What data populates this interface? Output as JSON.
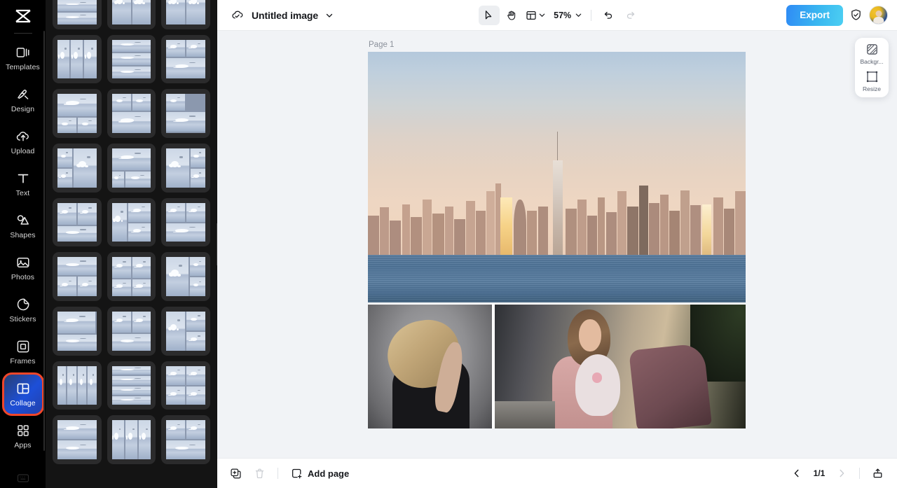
{
  "app": {
    "name": "CapCut",
    "logo_icon": "capcut-logo-icon"
  },
  "sidebar": {
    "items": [
      {
        "label": "Templates",
        "icon": "templates-icon",
        "active": false
      },
      {
        "label": "Design",
        "icon": "design-icon",
        "active": false
      },
      {
        "label": "Upload",
        "icon": "upload-cloud-icon",
        "active": false
      },
      {
        "label": "Text",
        "icon": "text-icon",
        "active": false
      },
      {
        "label": "Shapes",
        "icon": "shapes-icon",
        "active": false
      },
      {
        "label": "Photos",
        "icon": "photos-icon",
        "active": false
      },
      {
        "label": "Stickers",
        "icon": "stickers-icon",
        "active": false
      },
      {
        "label": "Frames",
        "icon": "frames-icon",
        "active": false
      },
      {
        "label": "Collage",
        "icon": "collage-icon",
        "active": true
      },
      {
        "label": "Apps",
        "icon": "apps-grid-icon",
        "active": false
      }
    ],
    "bottom_icon": "keyboard-icon",
    "active_highlight_color": "#f0462a",
    "active_fill_color": "#1d4fd8",
    "background_color": "#000000"
  },
  "template_panel": {
    "background_color": "#141414",
    "collapse_handle_icon": "chevron-left-icon",
    "layouts": [
      {
        "cols": "1fr",
        "rows": "1.1fr 1fr 1fr",
        "cells": [
          [
            1,
            1
          ],
          [
            1,
            1
          ],
          [
            1,
            1
          ]
        ]
      },
      {
        "cols": "1fr 1fr",
        "rows": "1fr",
        "cells": [
          [
            1,
            1
          ],
          [
            1,
            1
          ]
        ]
      },
      {
        "cols": "1fr 1fr",
        "rows": "1fr",
        "cells": [
          [
            1,
            1
          ],
          [
            1,
            1
          ]
        ]
      },
      {
        "cols": "1fr 1fr 1fr",
        "rows": "1fr",
        "cells": [
          [
            1,
            1
          ],
          [
            1,
            1
          ],
          [
            1,
            1
          ]
        ]
      },
      {
        "cols": "1fr",
        "rows": "1fr 1fr 1fr",
        "cells": [
          [
            1,
            1
          ],
          [
            1,
            1
          ],
          [
            1,
            1
          ]
        ]
      },
      {
        "cols": "1fr 1fr",
        "rows": "1fr 1.2fr",
        "cells": [
          [
            1,
            1
          ],
          [
            1,
            1
          ],
          [
            2,
            1
          ]
        ]
      },
      {
        "cols": "1fr 1fr",
        "rows": "1.4fr 1fr",
        "cells": [
          [
            2,
            1
          ],
          [
            1,
            1
          ],
          [
            1,
            1
          ]
        ]
      },
      {
        "cols": "1fr 1fr",
        "rows": "1fr 1.3fr",
        "cells": [
          [
            1,
            1
          ],
          [
            1,
            1
          ],
          [
            2,
            1
          ]
        ]
      },
      {
        "cols": "1fr 1fr",
        "rows": "1fr 1.2fr",
        "cells": [
          [
            1,
            1
          ],
          [
            2,
            1
          ],
          [
            1,
            1
          ]
        ]
      },
      {
        "cols": "1fr 1.6fr",
        "rows": "1fr 1fr",
        "cells": [
          [
            1,
            1
          ],
          [
            1,
            2
          ],
          [
            1,
            1
          ]
        ]
      },
      {
        "cols": "1fr 1fr 1fr",
        "rows": "1.4fr 1fr",
        "cells": [
          [
            3,
            1
          ],
          [
            1,
            1
          ],
          [
            2,
            1
          ]
        ]
      },
      {
        "cols": "1.5fr 1fr",
        "rows": "1fr 1fr",
        "cells": [
          [
            1,
            2
          ],
          [
            1,
            1
          ],
          [
            1,
            1
          ]
        ]
      },
      {
        "cols": "1fr 1fr",
        "rows": "1.4fr 1fr",
        "cells": [
          [
            1,
            1
          ],
          [
            1,
            1
          ],
          [
            2,
            1
          ]
        ]
      },
      {
        "cols": "1fr 1.5fr",
        "rows": "1fr 1fr",
        "cells": [
          [
            1,
            2
          ],
          [
            1,
            1
          ],
          [
            1,
            1
          ]
        ]
      },
      {
        "cols": "1fr 1fr",
        "rows": "1fr 1fr",
        "cells": [
          [
            1,
            1
          ],
          [
            1,
            1
          ],
          [
            2,
            1
          ]
        ]
      },
      {
        "cols": "1fr 1fr",
        "rows": "1fr 1.1fr",
        "cells": [
          [
            2,
            1
          ],
          [
            1,
            1
          ],
          [
            1,
            1
          ]
        ]
      },
      {
        "cols": "1fr 1fr",
        "rows": "1.2fr 1fr",
        "cells": [
          [
            1,
            1
          ],
          [
            1,
            1
          ],
          [
            1,
            1
          ],
          [
            1,
            1
          ]
        ]
      },
      {
        "cols": "1.4fr 1fr",
        "rows": "1fr 1fr",
        "cells": [
          [
            1,
            2
          ],
          [
            1,
            1
          ],
          [
            1,
            1
          ]
        ]
      },
      {
        "cols": "1fr",
        "rows": "1.4fr 1fr",
        "cells": [
          [
            1,
            1
          ],
          [
            2,
            1
          ]
        ]
      },
      {
        "cols": "1fr 1fr",
        "rows": "1.3fr 1fr",
        "cells": [
          [
            1,
            1
          ],
          [
            1,
            1
          ],
          [
            2,
            1
          ]
        ]
      },
      {
        "cols": "1fr 1fr",
        "rows": "1fr 1fr",
        "cells": [
          [
            1,
            2
          ],
          [
            1,
            1
          ],
          [
            1,
            1
          ]
        ]
      },
      {
        "cols": "1fr 1fr 1fr 1fr",
        "rows": "1fr",
        "cells": [
          [
            1,
            1
          ],
          [
            1,
            1
          ],
          [
            1,
            1
          ],
          [
            1,
            1
          ]
        ]
      },
      {
        "cols": "1fr",
        "rows": "1fr 1fr 1fr 1fr",
        "cells": [
          [
            1,
            1
          ],
          [
            1,
            1
          ],
          [
            1,
            1
          ],
          [
            1,
            1
          ]
        ]
      },
      {
        "cols": "1fr 1fr",
        "rows": "1fr 1fr",
        "cells": [
          [
            1,
            1
          ],
          [
            1,
            1
          ],
          [
            1,
            1
          ],
          [
            1,
            1
          ]
        ]
      },
      {
        "cols": "1fr",
        "rows": "1fr 1fr",
        "cells": [
          [
            1,
            1
          ],
          [
            1,
            1
          ]
        ]
      },
      {
        "cols": "1fr 1fr 1fr",
        "rows": "1fr",
        "cells": [
          [
            1,
            1
          ],
          [
            1,
            1
          ],
          [
            1,
            1
          ]
        ]
      },
      {
        "cols": "1fr 1fr",
        "rows": "1fr 1fr",
        "cells": [
          [
            1,
            1
          ],
          [
            1,
            1
          ],
          [
            2,
            1
          ]
        ]
      }
    ]
  },
  "toolbar": {
    "cloud_icon": "cloud-saved-icon",
    "title": "Untitled image",
    "title_caret_icon": "chevron-down-icon",
    "tools": [
      {
        "name": "select-tool",
        "icon": "cursor-arrow-icon",
        "selected": true
      },
      {
        "name": "hand-tool",
        "icon": "hand-icon",
        "selected": false
      },
      {
        "name": "layout-tool",
        "icon": "layout-grid-icon",
        "selected": false
      }
    ],
    "layout_caret_icon": "chevron-down-icon",
    "zoom_value": "57%",
    "zoom_caret_icon": "chevron-down-icon",
    "undo_icon": "undo-icon",
    "redo_icon": "redo-icon",
    "export_label": "Export",
    "export_color": "#39b6f0",
    "shield_icon": "shield-check-icon",
    "avatar_icon": "user-avatar"
  },
  "canvas": {
    "page_label": "Page 1",
    "background_color": "#f1f3f6",
    "photos": [
      {
        "name": "city-skyline-photo",
        "alt": "New York City skyline at sunset over water"
      },
      {
        "name": "portrait-photo",
        "alt": "Blonde woman in black jacket on gray background"
      },
      {
        "name": "girl-bunny-photo",
        "alt": "Young girl hugging a plush bunny on a sofa"
      }
    ]
  },
  "float_panel": {
    "items": [
      {
        "label": "Backgr...",
        "icon": "background-icon"
      },
      {
        "label": "Resize",
        "icon": "resize-icon"
      }
    ]
  },
  "bottom_bar": {
    "duplicate_icon": "duplicate-page-icon",
    "delete_icon": "trash-icon",
    "add_page_icon": "add-page-icon",
    "add_page_label": "Add page",
    "prev_icon": "chevron-left-icon",
    "page_indicator": "1/1",
    "next_icon": "chevron-right-icon",
    "export_tray_icon": "export-tray-icon"
  }
}
